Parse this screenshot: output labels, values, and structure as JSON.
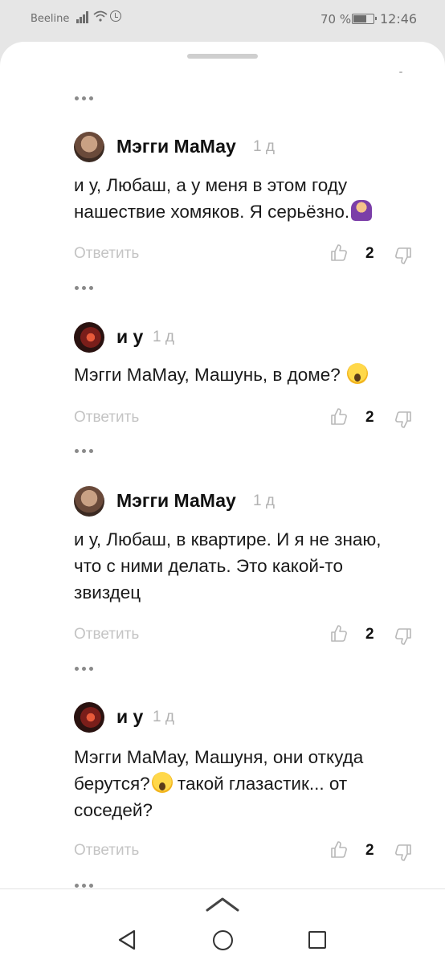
{
  "status_bar": {
    "carrier": "Beeline",
    "battery_percent": "70 %",
    "battery_level": 0.7,
    "time": "12:46",
    "icons": [
      "signal-icon",
      "wifi-icon",
      "alarm-icon",
      "battery-icon"
    ]
  },
  "comments": [
    {
      "author": "Мэгги МаМау",
      "age": "1 д",
      "line1": "и у, Любаш, а у меня в этом году",
      "line2": "нашествие хомяков. Я серьёзно.",
      "line3": "",
      "emoji": "facepalm-emoji",
      "reply": "Ответить",
      "likes": "2"
    },
    {
      "author": "и у",
      "age": "1 д",
      "line1": "Мэгги МаМау, Машунь, в доме?",
      "line2": "",
      "line3": "",
      "emoji": "scream-emoji",
      "reply": "Ответить",
      "likes": "2"
    },
    {
      "author": "Мэгги МаМау",
      "age": "1 д",
      "line1": "и у, Любаш, в квартире. И я не знаю,",
      "line2": "что с ними делать. Это какой-то",
      "line3": "звиздец",
      "emoji": "",
      "reply": "Ответить",
      "likes": "2"
    },
    {
      "author": "и у",
      "age": "1 д",
      "line1": "Мэгги МаМау, Машуня, они откуда",
      "line2a": "берутся?",
      "line2b": " такой глазастик... от",
      "line3": "соседей?",
      "emoji": "scream-emoji",
      "reply": "Ответить",
      "likes": "2"
    }
  ],
  "nav_bar": {
    "icons": [
      "chevron-up-icon",
      "back-icon",
      "home-icon",
      "recents-icon"
    ]
  }
}
